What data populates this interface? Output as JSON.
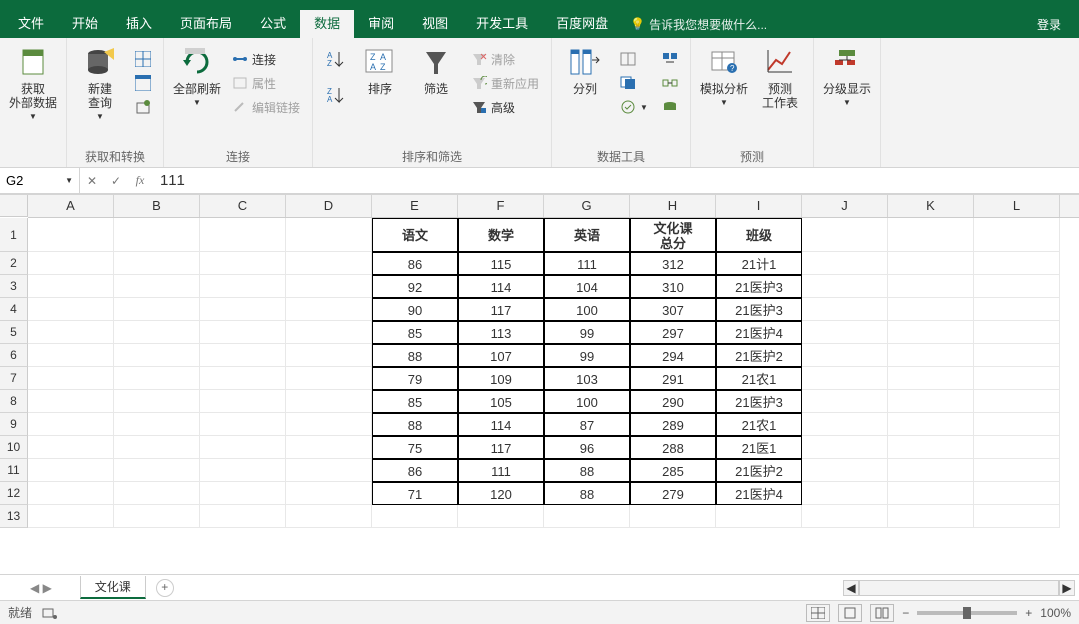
{
  "tabs": {
    "file": "文件",
    "home": "开始",
    "insert": "插入",
    "pagelayout": "页面布局",
    "formulas": "公式",
    "data": "数据",
    "review": "审阅",
    "view": "视图",
    "dev": "开发工具",
    "baidu": "百度网盘",
    "tellme": "告诉我您想要做什么...",
    "login": "登录"
  },
  "ribbon": {
    "get_external": "获取\n外部数据",
    "new_query": "新建\n查询",
    "refresh_all": "全部刷新",
    "conn": "连接",
    "prop": "属性",
    "editlink": "编辑链接",
    "sort": "排序",
    "filter": "筛选",
    "clear": "清除",
    "reapply": "重新应用",
    "advanced": "高级",
    "ttc": "分列",
    "sim": "模拟分析",
    "forecast": "预测\n工作表",
    "outline": "分级显示",
    "g1": "获取和转换",
    "g2": "连接",
    "g3": "排序和筛选",
    "g4": "数据工具",
    "g5": "预测"
  },
  "namebox": "G2",
  "formula": "111",
  "cols": [
    "A",
    "B",
    "C",
    "D",
    "E",
    "F",
    "G",
    "H",
    "I",
    "J",
    "K",
    "L"
  ],
  "rownums": [
    "1",
    "2",
    "3",
    "4",
    "5",
    "6",
    "7",
    "8",
    "9",
    "10",
    "11",
    "12",
    "13"
  ],
  "headers": {
    "E": "语文",
    "F": "数学",
    "G": "英语",
    "H": "文化课\n总分",
    "I": "班级"
  },
  "table": [
    {
      "E": "86",
      "F": "115",
      "G": "111",
      "H": "312",
      "I": "21计1"
    },
    {
      "E": "92",
      "F": "114",
      "G": "104",
      "H": "310",
      "I": "21医护3"
    },
    {
      "E": "90",
      "F": "117",
      "G": "100",
      "H": "307",
      "I": "21医护3"
    },
    {
      "E": "85",
      "F": "113",
      "G": "99",
      "H": "297",
      "I": "21医护4"
    },
    {
      "E": "88",
      "F": "107",
      "G": "99",
      "H": "294",
      "I": "21医护2"
    },
    {
      "E": "79",
      "F": "109",
      "G": "103",
      "H": "291",
      "I": "21农1"
    },
    {
      "E": "85",
      "F": "105",
      "G": "100",
      "H": "290",
      "I": "21医护3"
    },
    {
      "E": "88",
      "F": "114",
      "G": "87",
      "H": "289",
      "I": "21农1"
    },
    {
      "E": "75",
      "F": "117",
      "G": "96",
      "H": "288",
      "I": "21医1"
    },
    {
      "E": "86",
      "F": "111",
      "G": "88",
      "H": "285",
      "I": "21医护2"
    },
    {
      "E": "71",
      "F": "120",
      "G": "88",
      "H": "279",
      "I": "21医护4"
    }
  ],
  "sheet": "文化课",
  "status": "就绪",
  "zoom": "100%"
}
